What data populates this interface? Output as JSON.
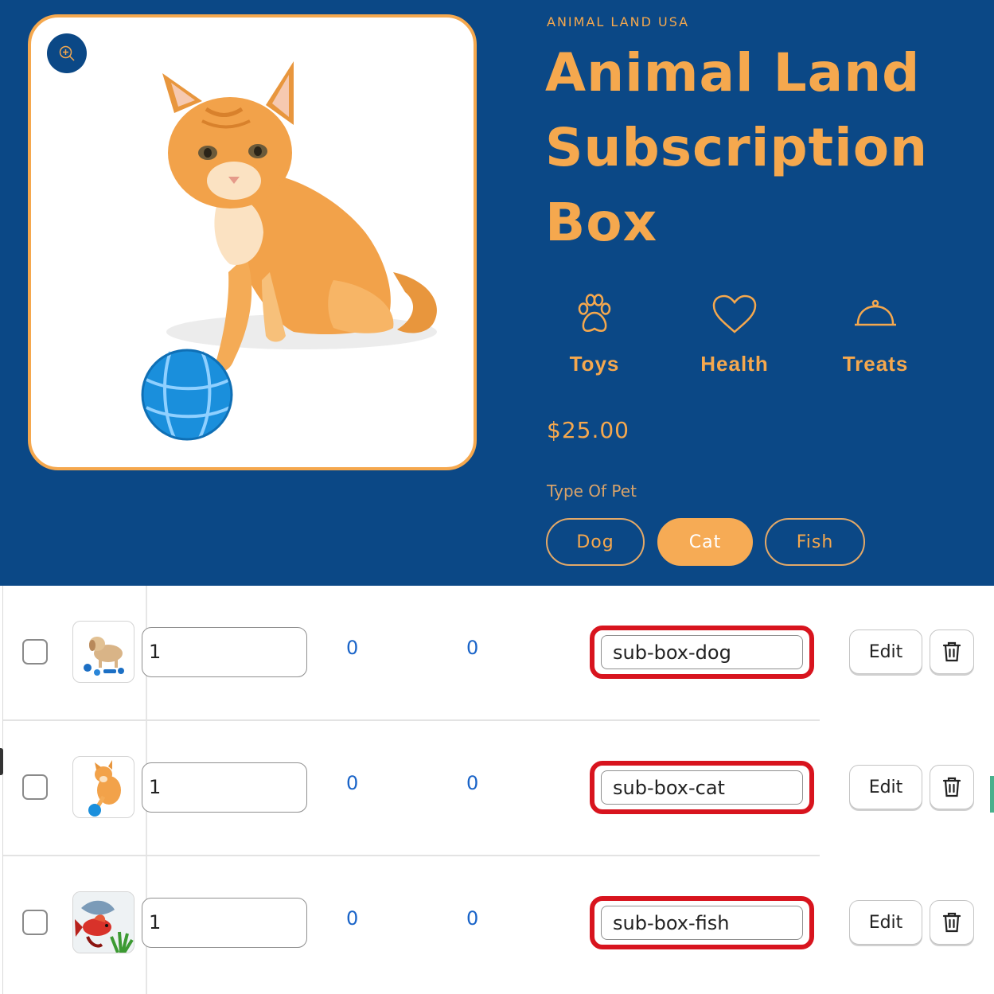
{
  "product": {
    "vendor": "ANIMAL LAND USA",
    "title": "Animal Land Subscription Box",
    "features": [
      {
        "label": "Toys",
        "icon": "paw-icon"
      },
      {
        "label": "Health",
        "icon": "heart-icon"
      },
      {
        "label": "Treats",
        "icon": "cloche-icon"
      }
    ],
    "price": "$25.00",
    "option_label": "Type Of Pet",
    "options": [
      "Dog",
      "Cat",
      "Fish"
    ],
    "selected_option": "Cat",
    "colors": {
      "brand_blue": "#0b4886",
      "accent_orange": "#f5a84e"
    }
  },
  "variants": {
    "rows": [
      {
        "qty": "1",
        "col_a": "0",
        "col_b": "0",
        "sku": "sub-box-dog",
        "edit_label": "Edit"
      },
      {
        "qty": "1",
        "col_a": "0",
        "col_b": "0",
        "sku": "sub-box-cat",
        "edit_label": "Edit"
      },
      {
        "qty": "1",
        "col_a": "0",
        "col_b": "0",
        "sku": "sub-box-fish",
        "edit_label": "Edit"
      }
    ],
    "highlight_color": "#d8141e"
  }
}
